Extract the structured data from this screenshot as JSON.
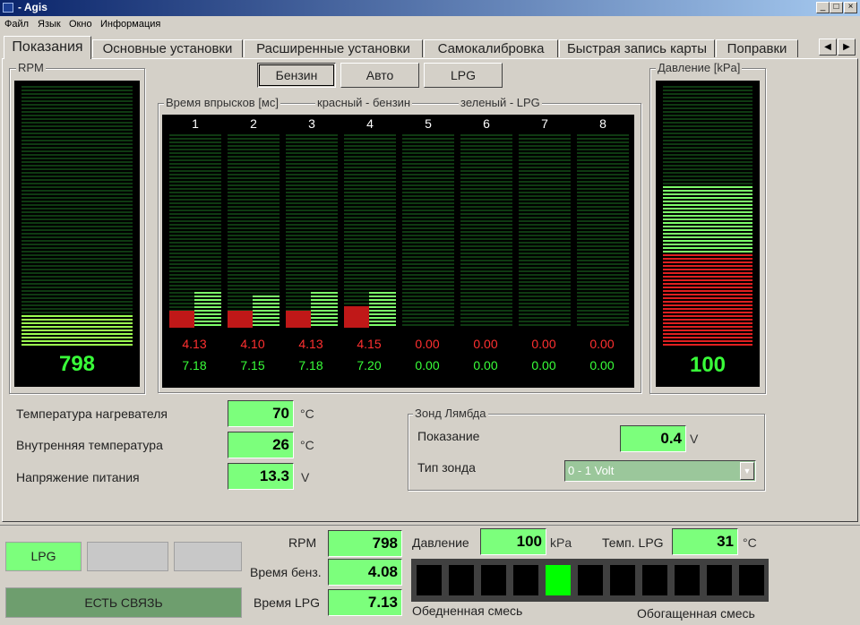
{
  "window": {
    "title": "- Agis"
  },
  "menu": {
    "items": [
      "Файл",
      "Язык",
      "Окно",
      "Информация"
    ]
  },
  "tabs": [
    "Показания",
    "Основные установки",
    "Расширенные установки",
    "Самокалибровка",
    "Быстрая запись карты",
    "Поправки"
  ],
  "rpm_panel": {
    "label": "RPM",
    "value": "798",
    "level": 0.12
  },
  "mode_buttons": {
    "petrol": "Бензин",
    "auto": "Авто",
    "lpg": "LPG",
    "selected": "petrol"
  },
  "injection": {
    "title": "Время впрысков [мс]",
    "legend_red": "красный - бензин",
    "legend_green": "зеленый - LPG",
    "channels": [
      {
        "num": "1",
        "petrol": "4.13",
        "lpg": "7.18",
        "petrol_level": 0.09,
        "lpg_level": 0.2
      },
      {
        "num": "2",
        "petrol": "4.10",
        "lpg": "7.15",
        "petrol_level": 0.09,
        "lpg_level": 0.18
      },
      {
        "num": "3",
        "petrol": "4.13",
        "lpg": "7.18",
        "petrol_level": 0.09,
        "lpg_level": 0.2
      },
      {
        "num": "4",
        "petrol": "4.15",
        "lpg": "7.20",
        "petrol_level": 0.11,
        "lpg_level": 0.2
      },
      {
        "num": "5",
        "petrol": "0.00",
        "lpg": "0.00",
        "petrol_level": 0,
        "lpg_level": 0
      },
      {
        "num": "6",
        "petrol": "0.00",
        "lpg": "0.00",
        "petrol_level": 0,
        "lpg_level": 0
      },
      {
        "num": "7",
        "petrol": "0.00",
        "lpg": "0.00",
        "petrol_level": 0,
        "lpg_level": 0
      },
      {
        "num": "8",
        "petrol": "0.00",
        "lpg": "0.00",
        "petrol_level": 0,
        "lpg_level": 0
      }
    ]
  },
  "pressure_panel": {
    "label": "Давление [kPa]",
    "value": "100",
    "red_level": 0.35,
    "green_level": 0.61
  },
  "sensors": {
    "heater_temp": {
      "label": "Температура нагревателя",
      "value": "70",
      "unit": "°C"
    },
    "internal_temp": {
      "label": "Внутренняя температура",
      "value": "26",
      "unit": "°C"
    },
    "supply_voltage": {
      "label": "Напряжение питания",
      "value": "13.3",
      "unit": "V"
    }
  },
  "lambda": {
    "title": "Зонд Лямбда",
    "reading_label": "Показание",
    "reading_value": "0.4",
    "reading_unit": "V",
    "type_label": "Тип зонда",
    "type_value": "0 - 1 Volt"
  },
  "status": {
    "lpg_indicator": "LPG",
    "connection": "ЕСТЬ СВЯЗЬ",
    "rpm_label": "RPM",
    "rpm_value": "798",
    "petrol_time_label": "Время бенз.",
    "petrol_time_value": "4.08",
    "lpg_time_label": "Время LPG",
    "lpg_time_value": "7.13",
    "pressure_label": "Давление",
    "pressure_value": "100",
    "pressure_unit": "kPa",
    "lpg_temp_label": "Темп. LPG",
    "lpg_temp_value": "31",
    "lpg_temp_unit": "°C",
    "mixture_lean": "Обедненная смесь",
    "mixture_rich": "Обогащенная смесь",
    "mixture_active_index": 4,
    "mixture_segments": 11
  },
  "colors": {
    "green": "#39ff39",
    "red": "#ff3030",
    "lcd": "#7cff7c"
  }
}
